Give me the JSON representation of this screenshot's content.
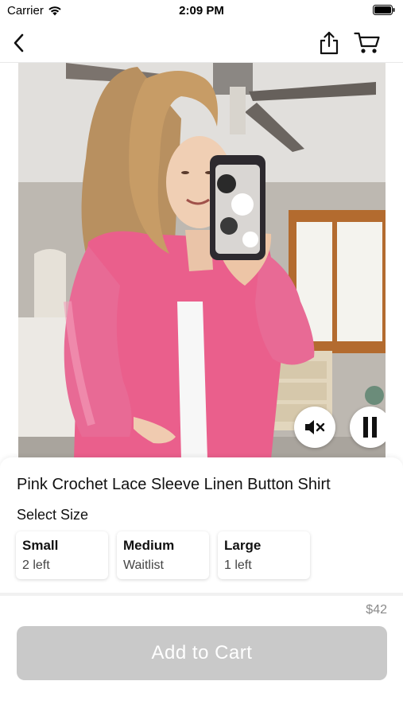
{
  "status_bar": {
    "carrier": "Carrier",
    "time": "2:09 PM"
  },
  "nav": {
    "back_icon": "chevron-left-icon",
    "share_icon": "share-icon",
    "cart_icon": "cart-icon"
  },
  "video": {
    "mute_icon": "speaker-muted-icon",
    "pause_icon": "pause-icon"
  },
  "product": {
    "title": "Pink Crochet Lace Sleeve Linen Button Shirt",
    "size_heading": "Select Size",
    "sizes": [
      {
        "name": "Small",
        "stock": "2 left"
      },
      {
        "name": "Medium",
        "stock": "Waitlist"
      },
      {
        "name": "Large",
        "stock": "1 left"
      }
    ],
    "price": "$42",
    "add_to_cart_label": "Add to Cart"
  },
  "colors": {
    "shirt_pink": "#ea5f8c",
    "button_disabled": "#c9c9c9"
  }
}
